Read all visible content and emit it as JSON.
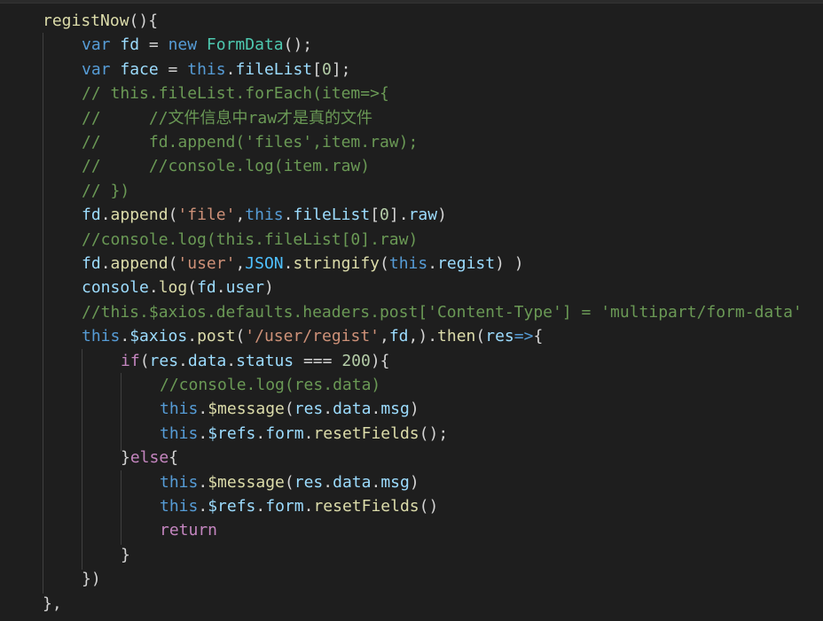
{
  "editor": {
    "theme": "dark",
    "background": "#1e1e1e",
    "token_colors": {
      "default": "#d4d4d4",
      "keyword": "#569cd6",
      "control": "#c586c0",
      "function": "#dcdcaa",
      "variable": "#9cdcfe",
      "string": "#ce9178",
      "number": "#b5cea8",
      "class": "#4ec9b0",
      "comment": "#6a9955",
      "constant": "#4fc1ff"
    },
    "lines": [
      {
        "indent": 0,
        "tokens": [
          [
            "function",
            "registNow"
          ],
          [
            "default",
            "(){"
          ]
        ]
      },
      {
        "indent": 1,
        "tokens": [
          [
            "keyword",
            "var"
          ],
          [
            "default",
            " "
          ],
          [
            "variable",
            "fd"
          ],
          [
            "default",
            " = "
          ],
          [
            "keyword",
            "new"
          ],
          [
            "default",
            " "
          ],
          [
            "class",
            "FormData"
          ],
          [
            "default",
            "();"
          ]
        ]
      },
      {
        "indent": 1,
        "tokens": [
          [
            "keyword",
            "var"
          ],
          [
            "default",
            " "
          ],
          [
            "variable",
            "face"
          ],
          [
            "default",
            " = "
          ],
          [
            "keyword",
            "this"
          ],
          [
            "default",
            "."
          ],
          [
            "variable",
            "fileList"
          ],
          [
            "default",
            "["
          ],
          [
            "number",
            "0"
          ],
          [
            "default",
            "];"
          ]
        ]
      },
      {
        "indent": 1,
        "tokens": [
          [
            "comment",
            "// this.fileList.forEach(item=>{"
          ]
        ]
      },
      {
        "indent": 1,
        "tokens": [
          [
            "comment",
            "//     //文件信息中raw才是真的文件"
          ]
        ]
      },
      {
        "indent": 1,
        "tokens": [
          [
            "comment",
            "//     fd.append('files',item.raw);"
          ]
        ]
      },
      {
        "indent": 1,
        "tokens": [
          [
            "comment",
            "//     //console.log(item.raw)"
          ]
        ]
      },
      {
        "indent": 1,
        "tokens": [
          [
            "comment",
            "// })"
          ]
        ]
      },
      {
        "indent": 1,
        "tokens": [
          [
            "variable",
            "fd"
          ],
          [
            "default",
            "."
          ],
          [
            "function",
            "append"
          ],
          [
            "default",
            "("
          ],
          [
            "string",
            "'file'"
          ],
          [
            "default",
            ","
          ],
          [
            "keyword",
            "this"
          ],
          [
            "default",
            "."
          ],
          [
            "variable",
            "fileList"
          ],
          [
            "default",
            "["
          ],
          [
            "number",
            "0"
          ],
          [
            "default",
            "]."
          ],
          [
            "variable",
            "raw"
          ],
          [
            "default",
            ")"
          ]
        ]
      },
      {
        "indent": 1,
        "tokens": [
          [
            "comment",
            "//console.log(this.fileList[0].raw)"
          ]
        ]
      },
      {
        "indent": 1,
        "tokens": [
          [
            "variable",
            "fd"
          ],
          [
            "default",
            "."
          ],
          [
            "function",
            "append"
          ],
          [
            "default",
            "("
          ],
          [
            "string",
            "'user'"
          ],
          [
            "default",
            ","
          ],
          [
            "constant",
            "JSON"
          ],
          [
            "default",
            "."
          ],
          [
            "function",
            "stringify"
          ],
          [
            "default",
            "("
          ],
          [
            "keyword",
            "this"
          ],
          [
            "default",
            "."
          ],
          [
            "variable",
            "regist"
          ],
          [
            "default",
            ") )"
          ]
        ]
      },
      {
        "indent": 1,
        "tokens": [
          [
            "variable",
            "console"
          ],
          [
            "default",
            "."
          ],
          [
            "function",
            "log"
          ],
          [
            "default",
            "("
          ],
          [
            "variable",
            "fd"
          ],
          [
            "default",
            "."
          ],
          [
            "variable",
            "user"
          ],
          [
            "default",
            ")"
          ]
        ]
      },
      {
        "indent": 1,
        "tokens": [
          [
            "comment",
            "//this.$axios.defaults.headers.post['Content-Type'] = 'multipart/form-data'"
          ]
        ]
      },
      {
        "indent": 1,
        "tokens": [
          [
            "keyword",
            "this"
          ],
          [
            "default",
            "."
          ],
          [
            "variable",
            "$axios"
          ],
          [
            "default",
            "."
          ],
          [
            "function",
            "post"
          ],
          [
            "default",
            "("
          ],
          [
            "string",
            "'/user/regist'"
          ],
          [
            "default",
            ","
          ],
          [
            "variable",
            "fd"
          ],
          [
            "default",
            ",)."
          ],
          [
            "function",
            "then"
          ],
          [
            "default",
            "("
          ],
          [
            "variable",
            "res"
          ],
          [
            "keyword",
            "=>"
          ],
          [
            "default",
            "{"
          ]
        ]
      },
      {
        "indent": 2,
        "tokens": [
          [
            "control",
            "if"
          ],
          [
            "default",
            "("
          ],
          [
            "variable",
            "res"
          ],
          [
            "default",
            "."
          ],
          [
            "variable",
            "data"
          ],
          [
            "default",
            "."
          ],
          [
            "variable",
            "status"
          ],
          [
            "default",
            " === "
          ],
          [
            "number",
            "200"
          ],
          [
            "default",
            "){"
          ]
        ]
      },
      {
        "indent": 3,
        "tokens": [
          [
            "comment",
            "//console.log(res.data)"
          ]
        ]
      },
      {
        "indent": 3,
        "tokens": [
          [
            "keyword",
            "this"
          ],
          [
            "default",
            "."
          ],
          [
            "function",
            "$message"
          ],
          [
            "default",
            "("
          ],
          [
            "variable",
            "res"
          ],
          [
            "default",
            "."
          ],
          [
            "variable",
            "data"
          ],
          [
            "default",
            "."
          ],
          [
            "variable",
            "msg"
          ],
          [
            "default",
            ")"
          ]
        ]
      },
      {
        "indent": 3,
        "tokens": [
          [
            "keyword",
            "this"
          ],
          [
            "default",
            "."
          ],
          [
            "variable",
            "$refs"
          ],
          [
            "default",
            "."
          ],
          [
            "variable",
            "form"
          ],
          [
            "default",
            "."
          ],
          [
            "function",
            "resetFields"
          ],
          [
            "default",
            "();"
          ]
        ]
      },
      {
        "indent": 2,
        "tokens": [
          [
            "default",
            "}"
          ],
          [
            "control",
            "else"
          ],
          [
            "default",
            "{"
          ]
        ]
      },
      {
        "indent": 3,
        "tokens": [
          [
            "keyword",
            "this"
          ],
          [
            "default",
            "."
          ],
          [
            "function",
            "$message"
          ],
          [
            "default",
            "("
          ],
          [
            "variable",
            "res"
          ],
          [
            "default",
            "."
          ],
          [
            "variable",
            "data"
          ],
          [
            "default",
            "."
          ],
          [
            "variable",
            "msg"
          ],
          [
            "default",
            ")"
          ]
        ]
      },
      {
        "indent": 3,
        "tokens": [
          [
            "keyword",
            "this"
          ],
          [
            "default",
            "."
          ],
          [
            "variable",
            "$refs"
          ],
          [
            "default",
            "."
          ],
          [
            "variable",
            "form"
          ],
          [
            "default",
            "."
          ],
          [
            "function",
            "resetFields"
          ],
          [
            "default",
            "()"
          ]
        ]
      },
      {
        "indent": 3,
        "tokens": [
          [
            "control",
            "return"
          ]
        ]
      },
      {
        "indent": 2,
        "tokens": [
          [
            "default",
            "}"
          ]
        ]
      },
      {
        "indent": 1,
        "tokens": [
          [
            "default",
            "})"
          ]
        ]
      },
      {
        "indent": 0,
        "tokens": [
          [
            "default",
            "},"
          ]
        ]
      }
    ]
  }
}
